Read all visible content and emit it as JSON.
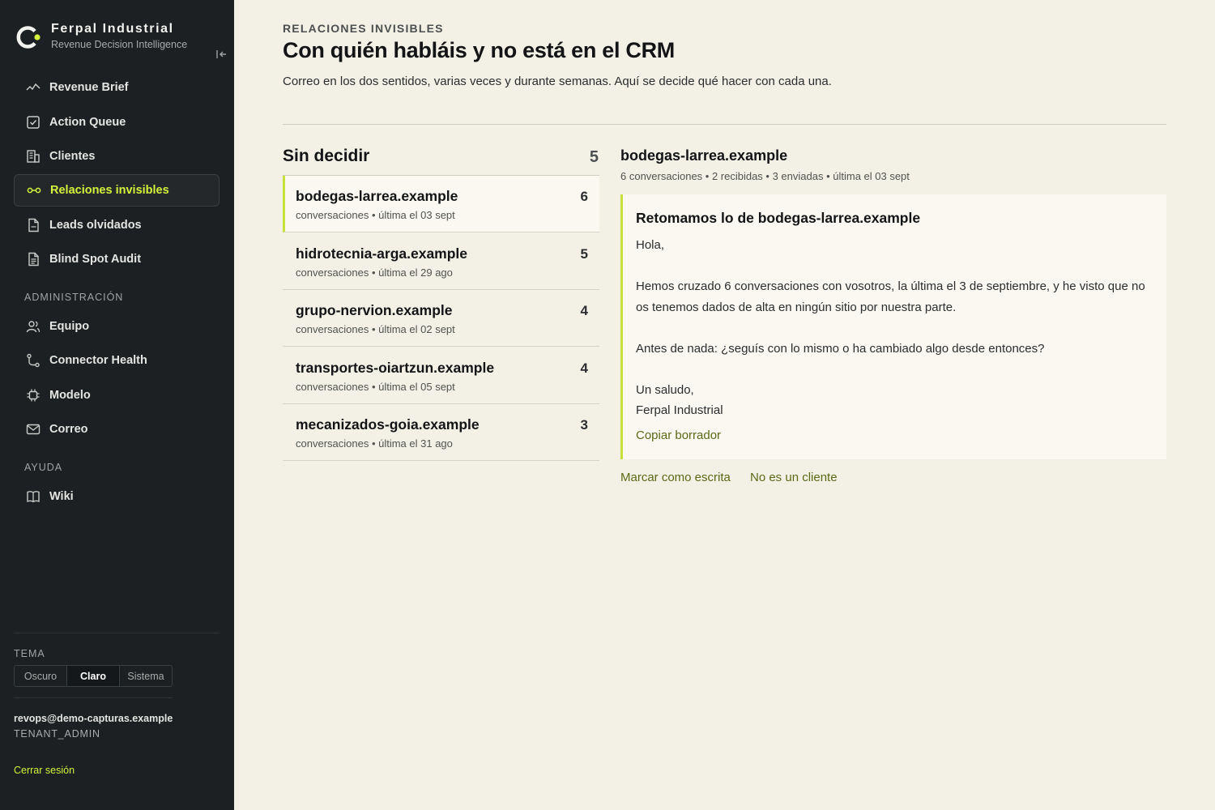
{
  "brand": {
    "name": "Ferpal Industrial",
    "subtitle": "Revenue Decision Intelligence"
  },
  "sidebar": {
    "nav": [
      {
        "label": "Revenue Brief",
        "icon": "activity-icon"
      },
      {
        "label": "Action Queue",
        "icon": "check-square-icon"
      },
      {
        "label": "Clientes",
        "icon": "building-icon"
      },
      {
        "label": "Relaciones invisibles",
        "icon": "link-icon",
        "active": true
      },
      {
        "label": "Leads olvidados",
        "icon": "file-icon"
      },
      {
        "label": "Blind Spot Audit",
        "icon": "file-text-icon"
      }
    ],
    "admin_label": "ADMINISTRACIÓN",
    "admin": [
      {
        "label": "Equipo",
        "icon": "users-icon"
      },
      {
        "label": "Connector Health",
        "icon": "route-icon"
      },
      {
        "label": "Modelo",
        "icon": "cpu-icon"
      },
      {
        "label": "Correo",
        "icon": "mail-icon"
      }
    ],
    "help_label": "AYUDA",
    "help": [
      {
        "label": "Wiki",
        "icon": "book-icon"
      }
    ],
    "theme": {
      "label": "TEMA",
      "options": [
        "Oscuro",
        "Claro",
        "Sistema"
      ],
      "selected": "Claro"
    },
    "user": {
      "email": "revops@demo-capturas.example",
      "role": "TENANT_ADMIN"
    },
    "logout": "Cerrar sesión"
  },
  "header": {
    "eyebrow": "RELACIONES INVISIBLES",
    "title": "Con quién habláis y no está en el CRM",
    "description": "Correo en los dos sentidos, varias veces y durante semanas. Aquí se decide qué hacer con cada una."
  },
  "list": {
    "title": "Sin decidir",
    "count": "5",
    "items": [
      {
        "domain": "bodegas-larrea.example",
        "meta": "conversaciones • última el 03 sept",
        "count": "6"
      },
      {
        "domain": "hidrotecnia-arga.example",
        "meta": "conversaciones • última el 29 ago",
        "count": "5"
      },
      {
        "domain": "grupo-nervion.example",
        "meta": "conversaciones • última el 02 sept",
        "count": "4"
      },
      {
        "domain": "transportes-oiartzun.example",
        "meta": "conversaciones • última el 05 sept",
        "count": "4"
      },
      {
        "domain": "mecanizados-goia.example",
        "meta": "conversaciones • última el 31 ago",
        "count": "3"
      }
    ]
  },
  "detail": {
    "title": "bodegas-larrea.example",
    "meta": "6 conversaciones • 2 recibidas • 3 enviadas • última el 03 sept",
    "draft": {
      "subject": "Retomamos lo de bodegas-larrea.example",
      "greeting": "Hola,",
      "paragraph1": "Hemos cruzado 6 conversaciones con vosotros, la última el 3 de septiembre, y he visto que no os tenemos dados de alta en ningún sitio por nuestra parte.",
      "paragraph2": "Antes de nada: ¿seguís con lo mismo o ha cambiado algo desde entonces?",
      "signoff": "Un saludo,",
      "signature": "Ferpal Industrial",
      "copy_label": "Copiar borrador"
    },
    "actions": {
      "mark_written": "Marcar como escrita",
      "not_client": "No es un cliente"
    }
  },
  "colors": {
    "accent": "#d4f23c",
    "accent_bar": "#c6e23a",
    "link": "#5b6a16",
    "sidebar_bg": "#1d2023",
    "main_bg": "#f3f1e6"
  }
}
